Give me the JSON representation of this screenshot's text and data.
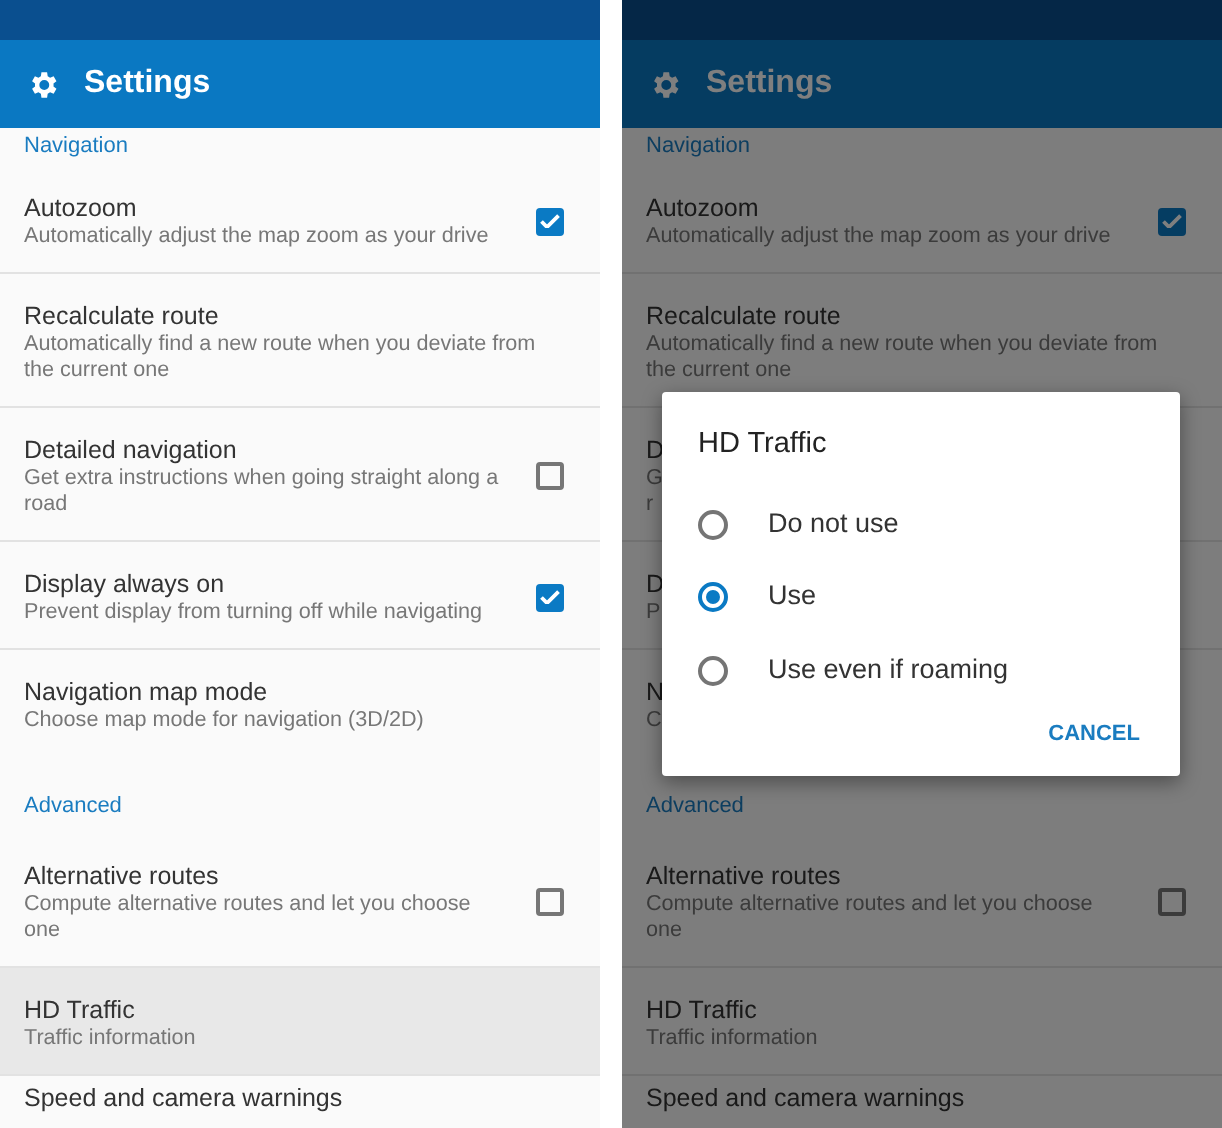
{
  "screens": [
    {
      "kind": "plain",
      "app_bar": {
        "title": "Settings"
      },
      "sections": [
        {
          "header": "Navigation",
          "items": [
            {
              "title": "Autozoom",
              "subtitle": "Automatically adjust the map zoom as your drive",
              "kind": "checkbox",
              "checked": true,
              "selected": false
            },
            {
              "title": "Recalculate route",
              "subtitle": "Automatically find a new route when you deviate from the current one",
              "kind": "plain",
              "selected": false
            },
            {
              "title": "Detailed navigation",
              "subtitle": "Get extra instructions when going straight along a road",
              "kind": "checkbox",
              "checked": false,
              "selected": false
            },
            {
              "title": "Display always on",
              "subtitle": "Prevent display from turning off while navigating",
              "kind": "checkbox",
              "checked": true,
              "selected": false
            },
            {
              "title": "Navigation map mode",
              "subtitle": "Choose map mode for navigation (3D/2D)",
              "kind": "plain",
              "selected": false
            }
          ]
        },
        {
          "header": "Advanced",
          "items": [
            {
              "title": "Alternative routes",
              "subtitle": "Compute alternative routes and let you choose one",
              "kind": "checkbox",
              "checked": false,
              "selected": false
            },
            {
              "title": "HD Traffic",
              "subtitle": "Traffic information",
              "kind": "plain",
              "selected": true
            },
            {
              "title": "Speed and camera warnings",
              "kind": "plain",
              "selected": false
            }
          ]
        }
      ]
    },
    {
      "kind": "dimmed",
      "app_bar": {
        "title": "Settings"
      },
      "sections": [
        {
          "header": "Navigation",
          "items": [
            {
              "title": "Autozoom",
              "subtitle": "Automatically adjust the map zoom as your drive",
              "kind": "checkbox",
              "checked": true
            },
            {
              "title": "Recalculate route",
              "subtitle": "Automatically find a new route when you deviate from the current one",
              "kind": "plain"
            },
            {
              "title": "D",
              "subtitle": "G r",
              "kind": "plain",
              "covered": true
            },
            {
              "title": "D",
              "subtitle": "P",
              "kind": "plain",
              "covered": true
            },
            {
              "title": "N",
              "subtitle": "C",
              "kind": "plain",
              "covered": true
            }
          ]
        },
        {
          "header": "Advanced",
          "items": [
            {
              "title": "Alternative routes",
              "subtitle": "Compute alternative routes and let you choose one",
              "kind": "checkbox",
              "checked": false
            },
            {
              "title": "HD Traffic",
              "subtitle": "Traffic information",
              "kind": "plain"
            },
            {
              "title": "Speed and camera warnings",
              "kind": "plain"
            }
          ]
        }
      ],
      "dialog": {
        "title": "HD Traffic",
        "options": [
          {
            "label": "Do not use",
            "selected": false
          },
          {
            "label": "Use",
            "selected": true
          },
          {
            "label": "Use even if roaming",
            "selected": false
          }
        ],
        "button": "CANCEL"
      }
    }
  ]
}
